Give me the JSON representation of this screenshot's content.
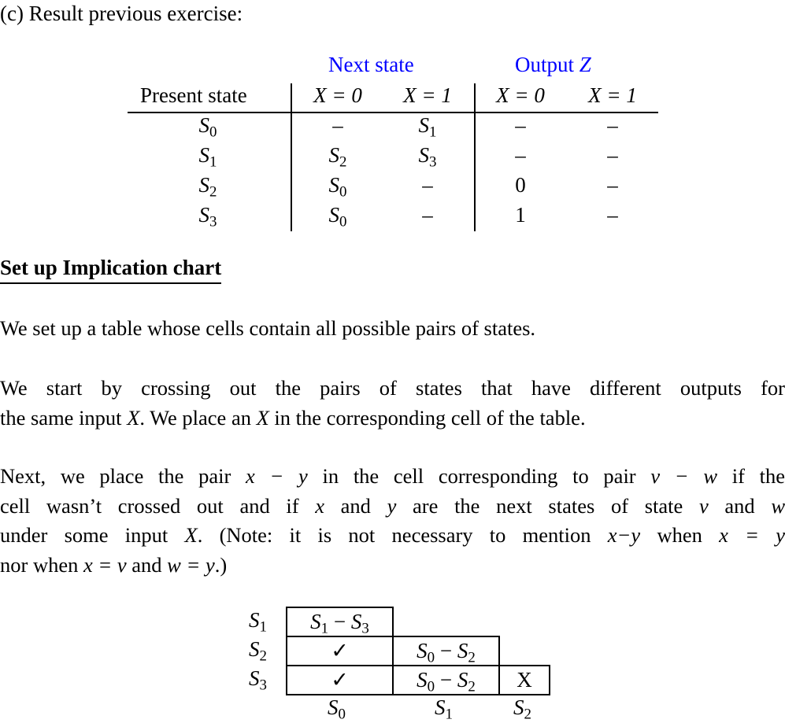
{
  "intro": "(c) Result previous exercise:",
  "state_table": {
    "group_headers": {
      "next_state": "Next state",
      "output": "Output ",
      "output_var": "Z"
    },
    "column_headers": [
      "Present state",
      "X = 0",
      "X = 1",
      "X = 0",
      "X = 1"
    ],
    "rows": [
      {
        "present": "S",
        "present_sub": "0",
        "next_x0": "–",
        "next_x0_sub": "",
        "next_x1": "S",
        "next_x1_sub": "1",
        "out_x0": "–",
        "out_x1": "–"
      },
      {
        "present": "S",
        "present_sub": "1",
        "next_x0": "S",
        "next_x0_sub": "2",
        "next_x1": "S",
        "next_x1_sub": "3",
        "out_x0": "–",
        "out_x1": "–"
      },
      {
        "present": "S",
        "present_sub": "2",
        "next_x0": "S",
        "next_x0_sub": "0",
        "next_x1": "–",
        "next_x1_sub": "",
        "out_x0": "0",
        "out_x1": "–"
      },
      {
        "present": "S",
        "present_sub": "3",
        "next_x0": "S",
        "next_x0_sub": "0",
        "next_x1": "–",
        "next_x1_sub": "",
        "out_x0": "1",
        "out_x1": "–"
      }
    ],
    "accent_color": "#0000ff"
  },
  "section_heading": "Set up Implication chart",
  "paragraphs": {
    "p1": "We set up a table whose cells contain all possible pairs of states.",
    "p2_l1": "We start by crossing out the pairs of states that have different outputs for",
    "p2_l2a": "the same input ",
    "p2_l2b": "X",
    "p2_l2c": ". We place an ",
    "p2_l2d": "X",
    "p2_l2e": " in the corresponding cell of the table.",
    "p3_l1a": "Next, we place the pair ",
    "p3_l1b": "x − y",
    "p3_l1c": " in the cell corresponding to pair ",
    "p3_l1d": "v − w",
    "p3_l1e": " if the",
    "p3_l2a": "cell wasn’t crossed out and if ",
    "p3_l2b": "x",
    "p3_l2c": " and ",
    "p3_l2d": "y",
    "p3_l2e": " are the next states of state ",
    "p3_l2f": "v",
    "p3_l2g": " and ",
    "p3_l2h": "w",
    "p3_l3a": "under some input ",
    "p3_l3b": "X",
    "p3_l3c": ". (Note: it is not necessary to mention ",
    "p3_l3d": "x−y",
    "p3_l3e": " when ",
    "p3_l3f": "x = y",
    "p3_l4a": "nor when ",
    "p3_l4b": "x = v",
    "p3_l4c": " and ",
    "p3_l4d": "w = y",
    "p3_l4e": ".)"
  },
  "implication_chart": {
    "row_labels": [
      {
        "s": "S",
        "sub": "1"
      },
      {
        "s": "S",
        "sub": "2"
      },
      {
        "s": "S",
        "sub": "3"
      }
    ],
    "col_labels": [
      {
        "s": "S",
        "sub": "0"
      },
      {
        "s": "S",
        "sub": "1"
      },
      {
        "s": "S",
        "sub": "2"
      }
    ],
    "cells": {
      "s1_s0": {
        "a": "S",
        "a_sub": "1",
        "dash": " − ",
        "b": "S",
        "b_sub": "3"
      },
      "s2_s0": "✓",
      "s2_s1": {
        "a": "S",
        "a_sub": "0",
        "dash": " − ",
        "b": "S",
        "b_sub": "2"
      },
      "s3_s0": "✓",
      "s3_s1": {
        "a": "S",
        "a_sub": "0",
        "dash": " − ",
        "b": "S",
        "b_sub": "2"
      },
      "s3_s2": "X"
    }
  }
}
